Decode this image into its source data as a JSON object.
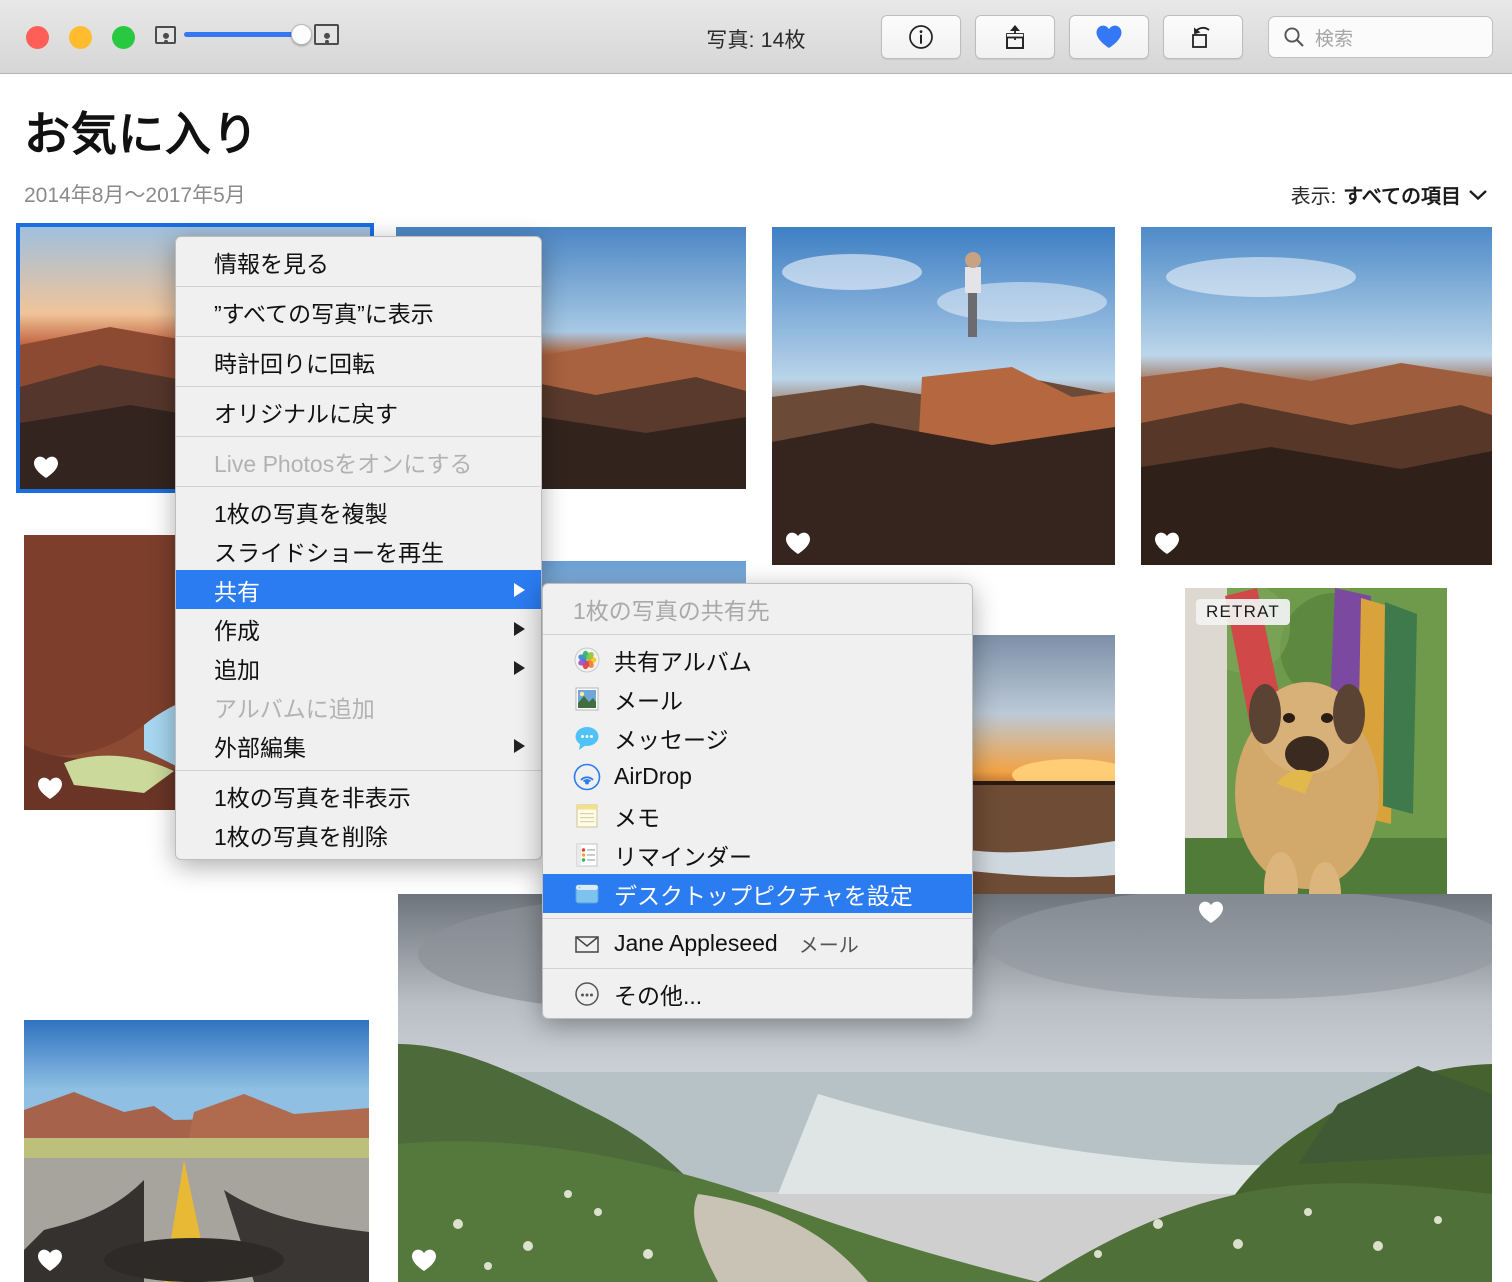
{
  "window": {
    "title": "写真: 14枚",
    "traffic_lights": [
      "close",
      "minimize",
      "zoom"
    ],
    "zoom_slider": {
      "value": 100
    }
  },
  "toolbar": {
    "info_label": "info-button",
    "share_label": "share-button",
    "favorite_label": "favorite-button",
    "rotate_label": "rotate-button",
    "search_placeholder": "検索"
  },
  "header": {
    "title": "お気に入り",
    "date_range": "2014年8月～2017年5月",
    "view_label": "表示:",
    "view_value": "すべての項目"
  },
  "photos": [
    {
      "name": "canyon-sunrise",
      "favorite": true,
      "selected": true,
      "badge": null
    },
    {
      "name": "canyon-wide",
      "favorite": false,
      "selected": false,
      "badge": null
    },
    {
      "name": "man-on-cliff",
      "favorite": true,
      "selected": false,
      "badge": null
    },
    {
      "name": "canyon-overlook",
      "favorite": true,
      "selected": false,
      "badge": null
    },
    {
      "name": "red-rock-arch",
      "favorite": true,
      "selected": false,
      "badge": null
    },
    {
      "name": "canyon-valley",
      "favorite": false,
      "selected": false,
      "badge": null
    },
    {
      "name": "desert-sunset",
      "favorite": false,
      "selected": false,
      "badge": null
    },
    {
      "name": "dog-in-hammock",
      "favorite": true,
      "selected": false,
      "badge": "RETRAT"
    },
    {
      "name": "desert-road",
      "favorite": true,
      "selected": false,
      "badge": null
    },
    {
      "name": "coastal-cliffs",
      "favorite": true,
      "selected": false,
      "badge": null
    }
  ],
  "context_menu": {
    "items": [
      {
        "label": "情報を見る",
        "disabled": false,
        "submenu": false,
        "highlight": false
      },
      {
        "separator": true
      },
      {
        "label": "”すべての写真”に表示",
        "disabled": false,
        "submenu": false,
        "highlight": false
      },
      {
        "separator": true
      },
      {
        "label": "時計回りに回転",
        "disabled": false,
        "submenu": false,
        "highlight": false
      },
      {
        "separator": true
      },
      {
        "label": "オリジナルに戻す",
        "disabled": false,
        "submenu": false,
        "highlight": false
      },
      {
        "separator": true
      },
      {
        "label": "Live Photosをオンにする",
        "disabled": true,
        "submenu": false,
        "highlight": false
      },
      {
        "separator": true
      },
      {
        "label": "1枚の写真を複製",
        "disabled": false,
        "submenu": false,
        "highlight": false
      },
      {
        "label": "スライドショーを再生",
        "disabled": false,
        "submenu": false,
        "highlight": false
      },
      {
        "label": "共有",
        "disabled": false,
        "submenu": true,
        "highlight": true
      },
      {
        "label": "作成",
        "disabled": false,
        "submenu": true,
        "highlight": false
      },
      {
        "label": "追加",
        "disabled": false,
        "submenu": true,
        "highlight": false
      },
      {
        "label": "アルバムに追加",
        "disabled": true,
        "submenu": false,
        "highlight": false
      },
      {
        "label": "外部編集",
        "disabled": false,
        "submenu": true,
        "highlight": false
      },
      {
        "separator": true
      },
      {
        "label": "1枚の写真を非表示",
        "disabled": false,
        "submenu": false,
        "highlight": false
      },
      {
        "label": "1枚の写真を削除",
        "disabled": false,
        "submenu": false,
        "highlight": false
      }
    ]
  },
  "share_submenu": {
    "heading": "1枚の写真の共有先",
    "items": [
      {
        "label": "共有アルバム",
        "icon": "photos-icon",
        "highlight": false,
        "suffix": null
      },
      {
        "label": "メール",
        "icon": "mail-icon",
        "highlight": false,
        "suffix": null
      },
      {
        "label": "メッセージ",
        "icon": "messages-icon",
        "highlight": false,
        "suffix": null
      },
      {
        "label": "AirDrop",
        "icon": "airdrop-icon",
        "highlight": false,
        "suffix": null
      },
      {
        "label": "メモ",
        "icon": "notes-icon",
        "highlight": false,
        "suffix": null
      },
      {
        "label": "リマインダー",
        "icon": "reminders-icon",
        "highlight": false,
        "suffix": null
      },
      {
        "label": "デスクトップピクチャを設定",
        "icon": "desktop-icon",
        "highlight": true,
        "suffix": null
      },
      {
        "separator": true
      },
      {
        "label": "Jane Appleseed",
        "icon": "envelope-icon",
        "highlight": false,
        "suffix": "メール"
      },
      {
        "separator": true
      },
      {
        "label": "その他...",
        "icon": "more-icon",
        "highlight": false,
        "suffix": null
      }
    ]
  },
  "colors": {
    "accent": "#2b7bf1",
    "selection_border": "#1a6ee0",
    "favorite_heart": "#3478f6",
    "slider_fill": "#3478f6"
  }
}
